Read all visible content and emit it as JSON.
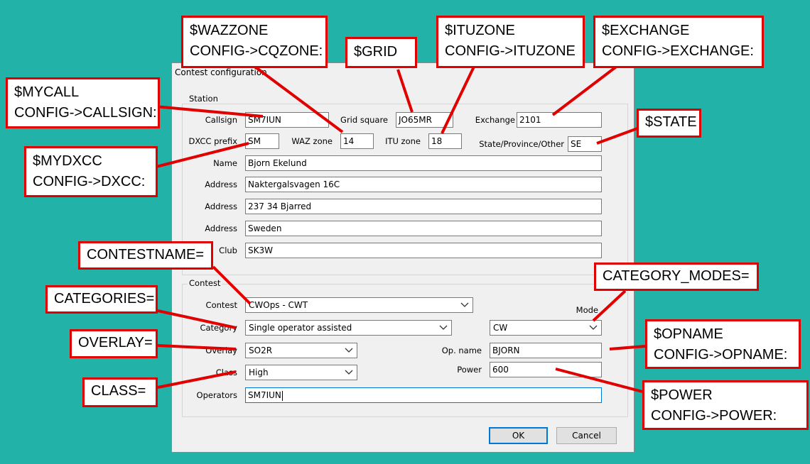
{
  "dialog": {
    "title": "Contest configuration",
    "station": {
      "group_label": "Station",
      "callsign_label": "Callsign",
      "callsign_value": "SM7IUN",
      "grid_label": "Grid square",
      "grid_value": "JO65MR",
      "exchange_label": "Exchange",
      "exchange_value": "2101",
      "dxcc_label": "DXCC prefix",
      "dxcc_value": "SM",
      "waz_label": "WAZ zone",
      "waz_value": "14",
      "itu_label": "ITU zone",
      "itu_value": "18",
      "state_label": "State/Province/Other",
      "state_value": "SE",
      "name_label": "Name",
      "name_value": "Bjorn Ekelund",
      "address_label": "Address",
      "address1_value": "Naktergalsvagen 16C",
      "address2_value": "237 34 Bjarred",
      "address3_value": "Sweden",
      "club_label": "Club",
      "club_value": "SK3W"
    },
    "contest": {
      "group_label": "Contest",
      "contest_label": "Contest",
      "contest_value": "CWOps - CWT",
      "category_label": "Category",
      "category_value": "Single operator assisted",
      "mode_label": "Mode",
      "mode_value": "CW",
      "overlay_label": "Overlay",
      "overlay_value": "SO2R",
      "opname_label": "Op. name",
      "opname_value": "BJORN",
      "class_label": "Class",
      "class_value": "High",
      "power_label": "Power",
      "power_value": "600",
      "operators_label": "Operators",
      "operators_value": "SM7IUN"
    },
    "ok_label": "OK",
    "cancel_label": "Cancel"
  },
  "callouts": {
    "wazzone": {
      "line1": "$WAZZONE",
      "line2": "CONFIG->CQZONE:"
    },
    "grid": {
      "line1": "$GRID"
    },
    "ituzone": {
      "line1": "$ITUZONE",
      "line2": "CONFIG->ITUZONE"
    },
    "exchange": {
      "line1": "$EXCHANGE",
      "line2": "CONFIG->EXCHANGE:"
    },
    "mycall": {
      "line1": "$MYCALL",
      "line2": "CONFIG->CALLSIGN:"
    },
    "state": {
      "line1": "$STATE"
    },
    "mydxcc": {
      "line1": "$MYDXCC",
      "line2": "CONFIG->DXCC:"
    },
    "contestname": {
      "line1": "CONTESTNAME="
    },
    "categories": {
      "line1": "CATEGORIES="
    },
    "category_modes": {
      "line1": "CATEGORY_MODES="
    },
    "overlay": {
      "line1": "OVERLAY="
    },
    "opname": {
      "line1": "$OPNAME",
      "line2": "CONFIG->OPNAME:"
    },
    "class": {
      "line1": "CLASS="
    },
    "power": {
      "line1": "$POWER",
      "line2": "CONFIG->POWER:"
    }
  },
  "colors": {
    "background": "#22b2a8",
    "callout_border": "#e00000",
    "dialog_bg": "#f0f0f0",
    "focus_border": "#0078d7"
  },
  "icons": [
    "chevron-down-icon"
  ]
}
